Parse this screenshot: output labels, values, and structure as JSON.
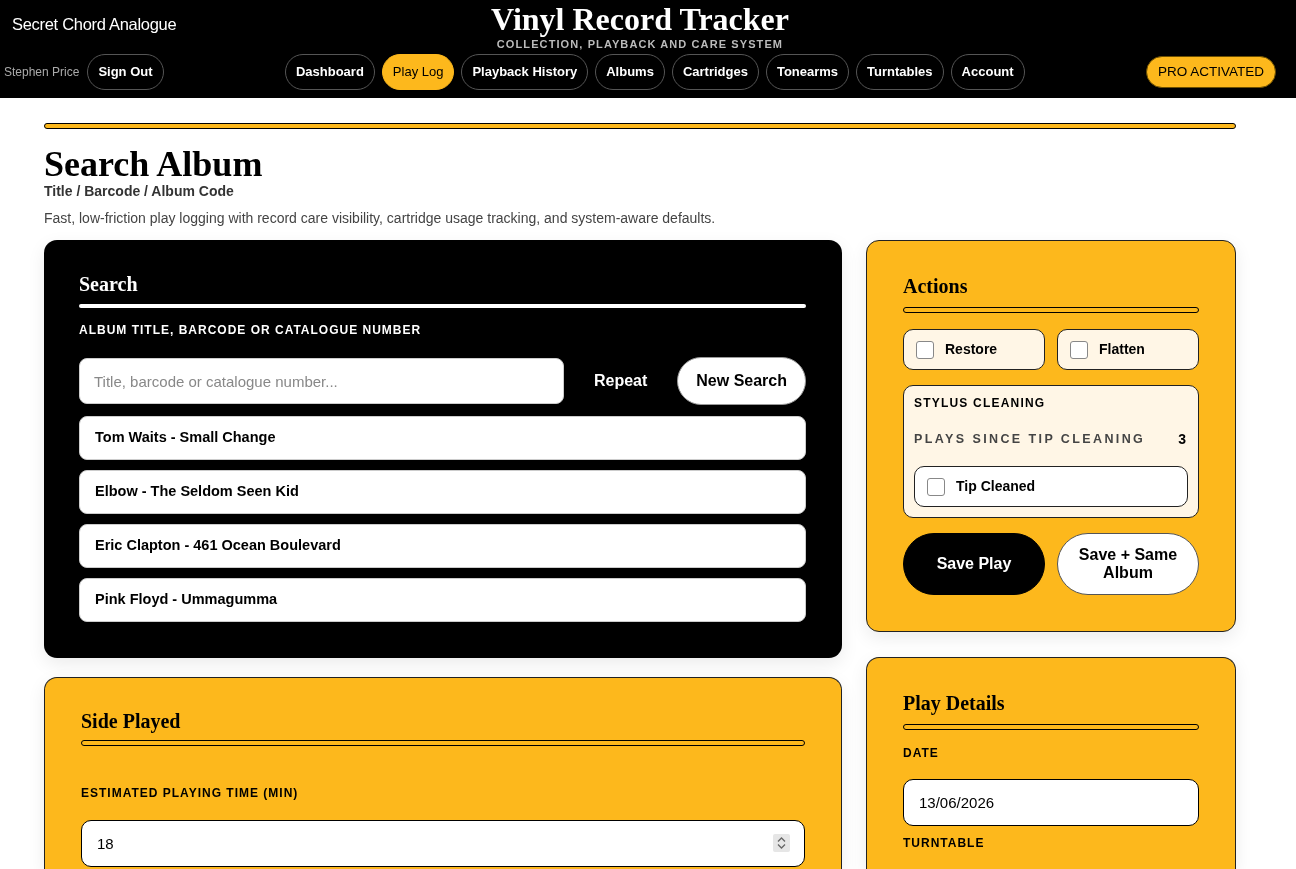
{
  "header": {
    "brand": "Secret Chord Analogue",
    "title": "Vinyl Record Tracker",
    "subtitle": "COLLECTION, PLAYBACK AND CARE SYSTEM",
    "user_name": "Stephen Price",
    "sign_out": "Sign Out",
    "nav": [
      {
        "label": "Dashboard",
        "selected": false
      },
      {
        "label": "Play Log",
        "selected": true
      },
      {
        "label": "Playback History",
        "selected": false
      },
      {
        "label": "Albums",
        "selected": false
      },
      {
        "label": "Cartridges",
        "selected": false
      },
      {
        "label": "Tonearms",
        "selected": false
      },
      {
        "label": "Turntables",
        "selected": false
      },
      {
        "label": "Account",
        "selected": false
      }
    ],
    "badge": "PRO ACTIVATED"
  },
  "page": {
    "title": "Search Album",
    "subtitle": "Title / Barcode / Album Code",
    "description": "Fast, low-friction play logging with record care visibility, cartridge usage tracking, and system-aware defaults."
  },
  "search": {
    "title": "Search",
    "field_label": "ALBUM TITLE, BARCODE OR CATALOGUE NUMBER",
    "placeholder": "Title, barcode or catalogue number...",
    "buttons": [
      {
        "label": "Repeat",
        "kind": "text"
      },
      {
        "label": "New Search",
        "kind": "pill"
      }
    ],
    "results": [
      "Tom Waits - Small Change",
      "Elbow - The Seldom Seen Kid",
      "Eric Clapton - 461 Ocean Boulevard",
      "Pink Floyd - Ummagumma"
    ]
  },
  "side_played": {
    "title": "Side Played",
    "fields": [
      {
        "label": "ESTIMATED PLAYING TIME (MIN)",
        "value": "18",
        "kind": "number"
      }
    ]
  },
  "actions": {
    "title": "Actions",
    "options": [
      {
        "label": "Restore",
        "checked": false
      },
      {
        "label": "Flatten",
        "checked": false
      }
    ],
    "stylus": {
      "title": "STYLUS CLEANING",
      "counter_label": "PLAYS SINCE TIP CLEANING",
      "counter_value": "3",
      "tip_cleaned": {
        "label": "Tip Cleaned",
        "checked": false
      }
    },
    "buttons": [
      {
        "label": "Save Play",
        "kind": "primary"
      },
      {
        "label": "Save + Same Album",
        "kind": "secondary"
      }
    ]
  },
  "play_details": {
    "title": "Play Details",
    "fields": [
      {
        "label": "DATE",
        "value": "13/06/2026"
      },
      {
        "label": "TURNTABLE"
      }
    ]
  }
}
